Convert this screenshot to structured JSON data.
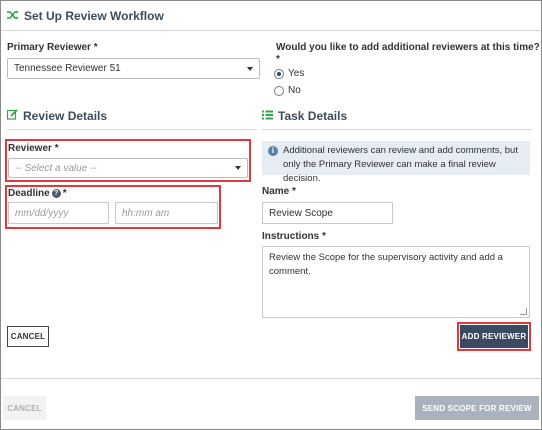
{
  "header": {
    "title": "Set Up Review Workflow",
    "icon": "shuffle-icon",
    "icon_color": "#2aa845"
  },
  "primary_reviewer": {
    "label": "Primary Reviewer *",
    "value": "Tennessee Reviewer 51"
  },
  "additional": {
    "question": "Would you like to add additional reviewers at this time?",
    "required_mark": "*",
    "options": [
      "Yes",
      "No"
    ],
    "selected": "Yes"
  },
  "review_details": {
    "title": "Review Details",
    "reviewer_label": "Reviewer *",
    "reviewer_placeholder": "-- Select a value --",
    "deadline_label": "Deadline",
    "deadline_required": "*",
    "date_placeholder": "mm/dd/yyyy",
    "time_placeholder": "hh:mm am"
  },
  "task_details": {
    "title": "Task Details",
    "info": "Additional reviewers can review and add comments, but only the Primary Reviewer can make a final review decision.",
    "name_label": "Name *",
    "name_value": "Review Scope",
    "instructions_label": "Instructions *",
    "instructions_value": "Review the Scope for the supervisory activity and add a comment."
  },
  "buttons": {
    "cancel_inner": "CANCEL",
    "add_reviewer": "ADD REVIEWER",
    "cancel_footer": "CANCEL",
    "send_scope": "SEND SCOPE FOR REVIEW"
  },
  "colors": {
    "accent_green": "#2aa845",
    "highlight_red": "#e0393e",
    "info_bg": "#e6ecf3",
    "primary_btn": "#3b4a63",
    "disabled_btn": "#a9b2bd"
  }
}
